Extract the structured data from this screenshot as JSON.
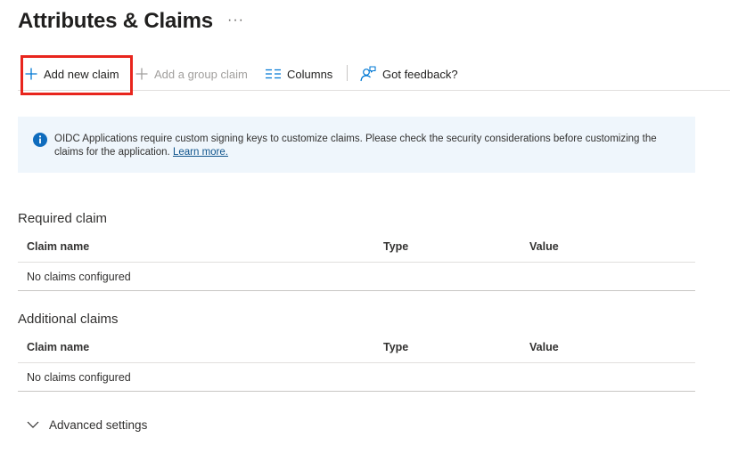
{
  "page": {
    "title": "Attributes & Claims",
    "more_label": "···"
  },
  "toolbar": {
    "add_new_claim": "Add new claim",
    "add_group_claim": "Add a group claim",
    "columns": "Columns",
    "feedback": "Got feedback?"
  },
  "info_banner": {
    "text": "OIDC Applications require custom signing keys to customize claims. Please check the security considerations before customizing the claims for the application.",
    "link": "Learn more."
  },
  "required": {
    "title": "Required claim",
    "columns": [
      "Claim name",
      "Type",
      "Value"
    ],
    "empty_text": "No claims configured"
  },
  "additional": {
    "title": "Additional claims",
    "columns": [
      "Claim name",
      "Type",
      "Value"
    ],
    "empty_text": "No claims configured"
  },
  "advanced": {
    "label": "Advanced settings"
  },
  "colors": {
    "accent": "#0078d4",
    "highlight": "#e8251d",
    "banner_bg": "#eff6fc",
    "info_icon": "#0f6cbd"
  },
  "icons": {
    "add_claim": "plus-icon",
    "add_group": "plus-icon",
    "columns": "columns-icon",
    "feedback": "feedback-person-icon",
    "info": "info-icon",
    "advanced": "chevron-down-icon",
    "more": "more-icon"
  }
}
